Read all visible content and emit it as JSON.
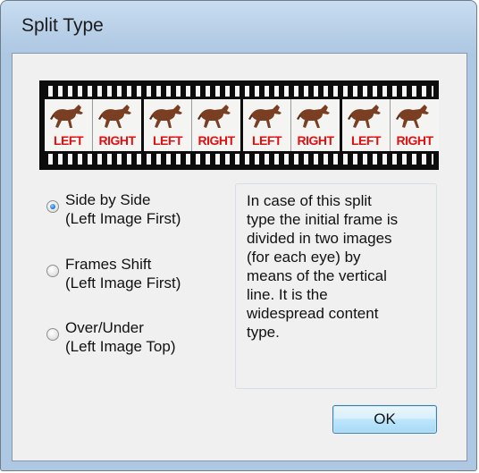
{
  "window": {
    "title": "Split Type"
  },
  "filmstrip": {
    "frames": [
      {
        "left": "LEFT",
        "right": "RIGHT"
      },
      {
        "left": "LEFT",
        "right": "RIGHT"
      },
      {
        "left": "LEFT",
        "right": "RIGHT"
      },
      {
        "left": "LEFT",
        "right": "RIGHT"
      }
    ]
  },
  "options": [
    {
      "line1": "Side by Side",
      "line2": "(Left Image First)",
      "checked": true
    },
    {
      "line1": "Frames Shift",
      "line2": "(Left Image First)",
      "checked": false
    },
    {
      "line1": "Over/Under",
      "line2": "(Left Image Top)",
      "checked": false
    }
  ],
  "description": {
    "lines": [
      "In case of this split",
      "type the initial frame is",
      "divided in two images",
      "(for each eye) by",
      "means of the vertical",
      "line. It is the",
      "widespread content",
      "type."
    ]
  },
  "buttons": {
    "ok_label": "OK"
  },
  "colors": {
    "label_red": "#e01010",
    "radio_selected": "#1d6fc9",
    "button_border": "#3c7fb1"
  }
}
